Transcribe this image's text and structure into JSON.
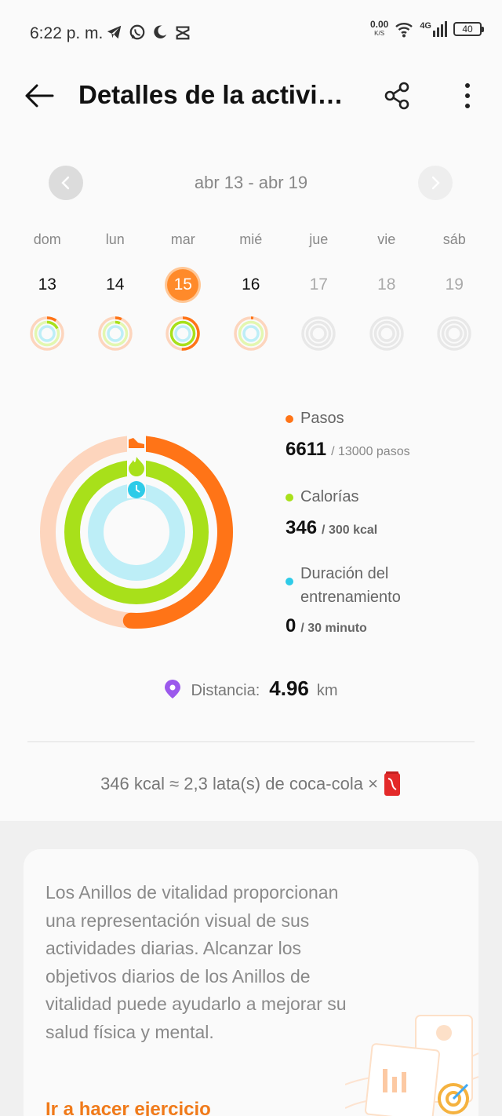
{
  "status_bar": {
    "time": "6:22 p. m.",
    "net_speed": "0.00",
    "net_unit": "K/S",
    "network_type": "4G",
    "battery": "40"
  },
  "header": {
    "title": "Detalles de la activi…"
  },
  "week": {
    "range": "abr 13 - abr 19",
    "days": [
      {
        "name": "dom",
        "num": "13"
      },
      {
        "name": "lun",
        "num": "14"
      },
      {
        "name": "mar",
        "num": "15"
      },
      {
        "name": "mié",
        "num": "16"
      },
      {
        "name": "jue",
        "num": "17"
      },
      {
        "name": "vie",
        "num": "18"
      },
      {
        "name": "sáb",
        "num": "19"
      }
    ],
    "selected_day": "15"
  },
  "summary": {
    "steps": {
      "label": "Pasos",
      "value": "6611",
      "goal": "/ 13000 pasos",
      "progress": 0.51,
      "color": "#ff7417"
    },
    "calories": {
      "label": "Calorías",
      "value": "346",
      "goal": "/ 300 kcal",
      "progress": 1.0,
      "color": "#a8e01a"
    },
    "training": {
      "label": "Duración del entrenamiento",
      "value": "0",
      "goal": "/ 30 minuto",
      "progress": 0.0,
      "color": "#2ecbe8"
    },
    "distance": {
      "label": "Distancia:",
      "value": "4.96",
      "unit": "km"
    }
  },
  "equivalence": {
    "text": "346 kcal ≈ 2,3 lata(s) de coca-cola ×"
  },
  "info": {
    "text": "Los Anillos de vitalidad proporcionan una representación visual de sus actividades diarias. Alcanzar los objetivos diarios de los Anillos de vitalidad puede ayudarlo a mejorar su salud física y mental.",
    "link": "Ir a hacer ejercicio"
  },
  "colors": {
    "accent": "#ff8a2a",
    "steps": "#ff7417",
    "steps_track": "#fdd5bd",
    "calories": "#a8e01a",
    "training_track": "#bdeef7"
  }
}
